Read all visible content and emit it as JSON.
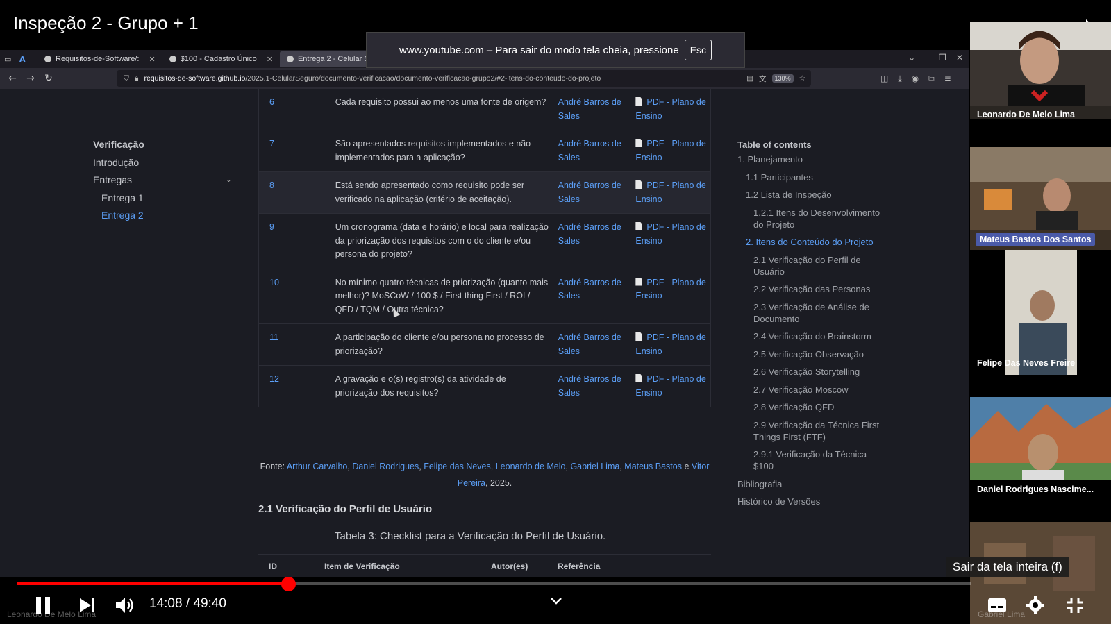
{
  "video": {
    "title": "Inspeção 2 - Grupo + 1",
    "time_current": "14:08",
    "time_total": "49:40",
    "time_display": "14:08 / 49:40",
    "progress_fraction": 0.284,
    "exit_fullscreen_tip": "Sair da tela inteira (f)"
  },
  "fullscreen_notice": {
    "text": "www.youtube.com – Para sair do modo tela cheia, pressione",
    "key": "Esc"
  },
  "browser": {
    "tabs": [
      {
        "label": "Requisitos-de-Software/:"
      },
      {
        "label": "$100 - Cadastro Único"
      },
      {
        "label": "Entrega 2 - Celular Seg"
      }
    ],
    "url_domain": "requisitos-de-software.github.io",
    "url_path": "/2025.1-CelularSeguro/documento-verificacao/documento-verificacao-grupo2/#2-itens-do-conteudo-do-projeto",
    "zoom": "130%"
  },
  "leftnav": {
    "items": [
      {
        "label": "Verificação"
      },
      {
        "label": "Introdução"
      },
      {
        "label": "Entregas"
      },
      {
        "label": "Entrega 1"
      },
      {
        "label": "Entrega 2"
      }
    ]
  },
  "table_rows": [
    {
      "id": "6",
      "item": "Cada requisito possui ao menos uma fonte de origem?",
      "author": "André Barros de Sales",
      "ref": "PDF - Plano de Ensino"
    },
    {
      "id": "7",
      "item": "São apresentados requisitos implementados e não implementados para a aplicação?",
      "author": "André Barros de Sales",
      "ref": "PDF - Plano de Ensino"
    },
    {
      "id": "8",
      "item": "Está sendo apresentado como requisito pode ser verificado na aplicação (critério de aceitação).",
      "author": "André Barros de Sales",
      "ref": "PDF - Plano de Ensino"
    },
    {
      "id": "9",
      "item": "Um cronograma (data e horário) e local para realização da priorização dos requisitos com o do cliente e/ou persona do projeto?",
      "author": "André Barros de Sales",
      "ref": "PDF - Plano de Ensino"
    },
    {
      "id": "10",
      "item": "No mínimo quatro técnicas de priorização (quanto mais melhor)? MoSCoW / 100 $ / First thing First / ROI / QFD / TQM / Outra técnica?",
      "author": "André Barros de Sales",
      "ref": "PDF - Plano de Ensino"
    },
    {
      "id": "11",
      "item": "A participação do cliente e/ou persona no processo de priorização?",
      "author": "André Barros de Sales",
      "ref": "PDF - Plano de Ensino"
    },
    {
      "id": "12",
      "item": "A gravação e o(s) registro(s) da atividade de priorização dos requisitos?",
      "author": "André Barros de Sales",
      "ref": "PDF - Plano de Ensino"
    }
  ],
  "fonte": {
    "prefix": "Fonte: ",
    "authors": [
      "Arthur Carvalho",
      "Daniel Rodrigues",
      "Felipe das Neves",
      "Leonardo de Melo",
      "Gabriel Lima",
      "Mateus Bastos"
    ],
    "last_author": "Vitor Pereira",
    "and_word": "e",
    "year": ", 2025."
  },
  "section": {
    "title": "2.1 Verificação do Perfil de Usuário",
    "caption": "Tabela 3: Checklist para a Verificação do Perfil de Usuário.",
    "headers": [
      "ID",
      "Item de Verificação",
      "Autor(es)",
      "Referência"
    ]
  },
  "toc": {
    "title": "Table of contents",
    "items": [
      {
        "label": "1. Planejamento",
        "level": 1
      },
      {
        "label": "1.1 Participantes",
        "level": 2
      },
      {
        "label": "1.2 Lista de Inspeção",
        "level": 2
      },
      {
        "label": "1.2.1 Itens do Desenvolvimento do Projeto",
        "level": 3
      },
      {
        "label": "2. Itens do Conteúdo do Projeto",
        "level": 2,
        "current": true
      },
      {
        "label": "2.1 Verificação do Perfil de Usuário",
        "level": 3
      },
      {
        "label": "2.2 Verificação das Personas",
        "level": 3
      },
      {
        "label": "2.3 Verificação de Análise de Documento",
        "level": 3
      },
      {
        "label": "2.4 Verificação do Brainstorm",
        "level": 3
      },
      {
        "label": "2.5 Verificação Observação",
        "level": 3
      },
      {
        "label": "2.6 Verificação Storytelling",
        "level": 3
      },
      {
        "label": "2.7 Verificação Moscow",
        "level": 3
      },
      {
        "label": "2.8 Verificação QFD",
        "level": 3
      },
      {
        "label": "2.9 Verificação da Técnica First Things First (FTF)",
        "level": 3
      },
      {
        "label": "2.9.1 Verificação da Técnica $100",
        "level": 3
      },
      {
        "label": "Bibliografia",
        "level": 1
      },
      {
        "label": "Histórico de Versões",
        "level": 1
      }
    ]
  },
  "participants": [
    {
      "name": "Leonardo De Melo Lima"
    },
    {
      "name": "Mateus Bastos Dos Santos"
    },
    {
      "name": "Felipe Das Neves Freire"
    },
    {
      "name": "Daniel Rodrigues Nascime..."
    },
    {
      "name": "Gabriel Lima"
    }
  ],
  "ghost_label_left": "Leonardo De Melo Lima",
  "colors": {
    "accent": "#5b9ef5",
    "progress": "#ff0000",
    "speaker_tag": "#4a5aa8"
  }
}
